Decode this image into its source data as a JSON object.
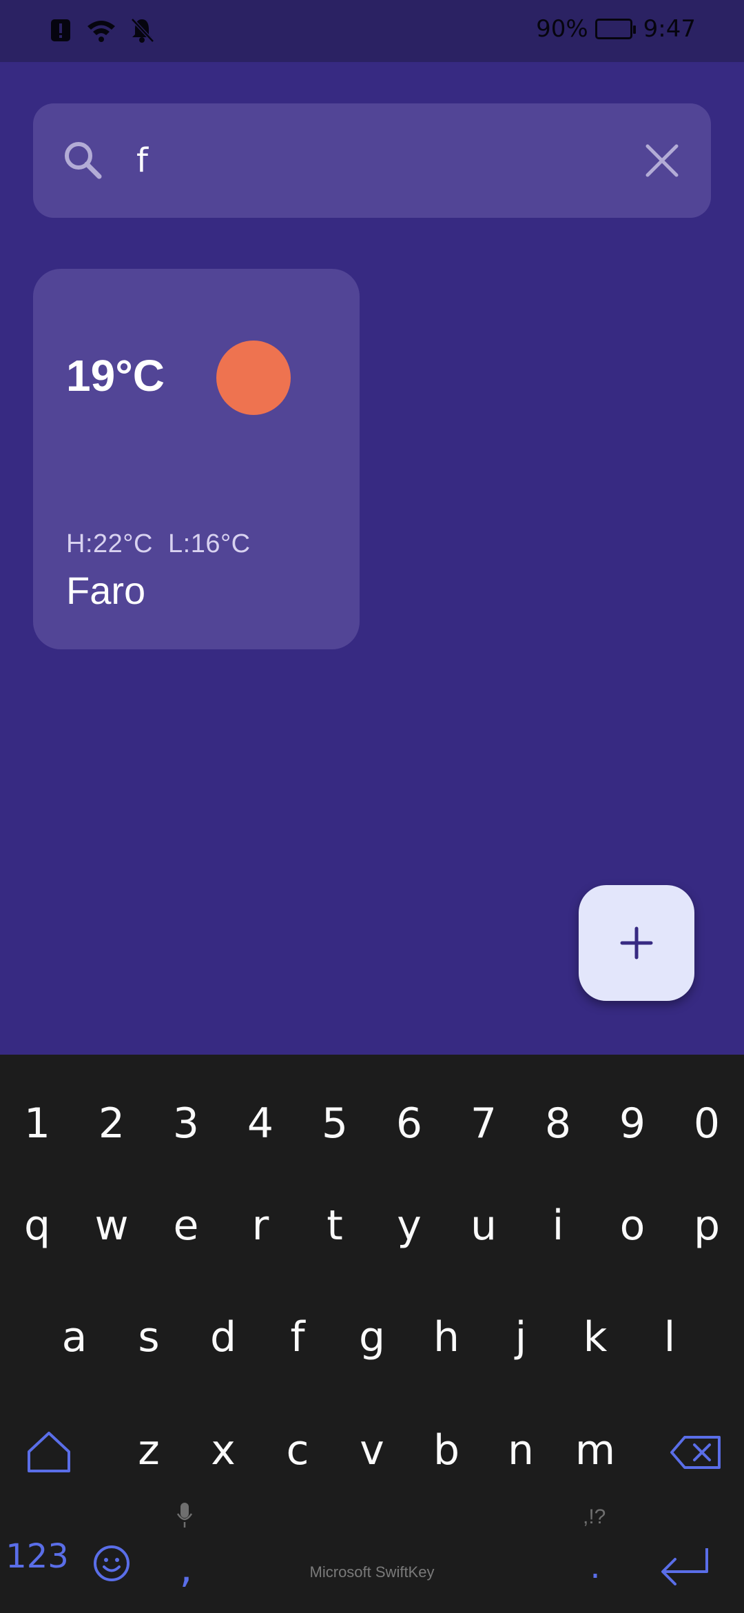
{
  "status_bar": {
    "battery_percent": "90%",
    "time": "9:47",
    "icons": [
      "alert-icon",
      "wifi-icon",
      "notifications-off-icon",
      "battery-charging-icon"
    ]
  },
  "search": {
    "value": "f",
    "placeholder": "",
    "icon": "search-icon",
    "clear_icon": "close-icon"
  },
  "weather_card": {
    "temperature": "19°C",
    "high_low": "H:22°C  L:16°C",
    "city": "Faro",
    "condition_icon": "sun-icon",
    "sun_color": "#ee7350"
  },
  "fab": {
    "icon": "plus-icon",
    "label": "+"
  },
  "keyboard": {
    "row_numbers": [
      "1",
      "2",
      "3",
      "4",
      "5",
      "6",
      "7",
      "8",
      "9",
      "0"
    ],
    "row_top": [
      "q",
      "w",
      "e",
      "r",
      "t",
      "y",
      "u",
      "i",
      "o",
      "p"
    ],
    "row_middle": [
      "a",
      "s",
      "d",
      "f",
      "g",
      "h",
      "j",
      "k",
      "l"
    ],
    "row_bottom": [
      "z",
      "x",
      "c",
      "v",
      "b",
      "n",
      "m"
    ],
    "symbols_label": "123",
    "comma_label": ",",
    "period_label": ".",
    "punctuation_hint": ",!?",
    "brand": "Microsoft SwiftKey",
    "accent_color": "#5a6ee8"
  },
  "colors": {
    "background": "#372a82",
    "card": "#524596",
    "keyboard": "#1c1c1c"
  }
}
